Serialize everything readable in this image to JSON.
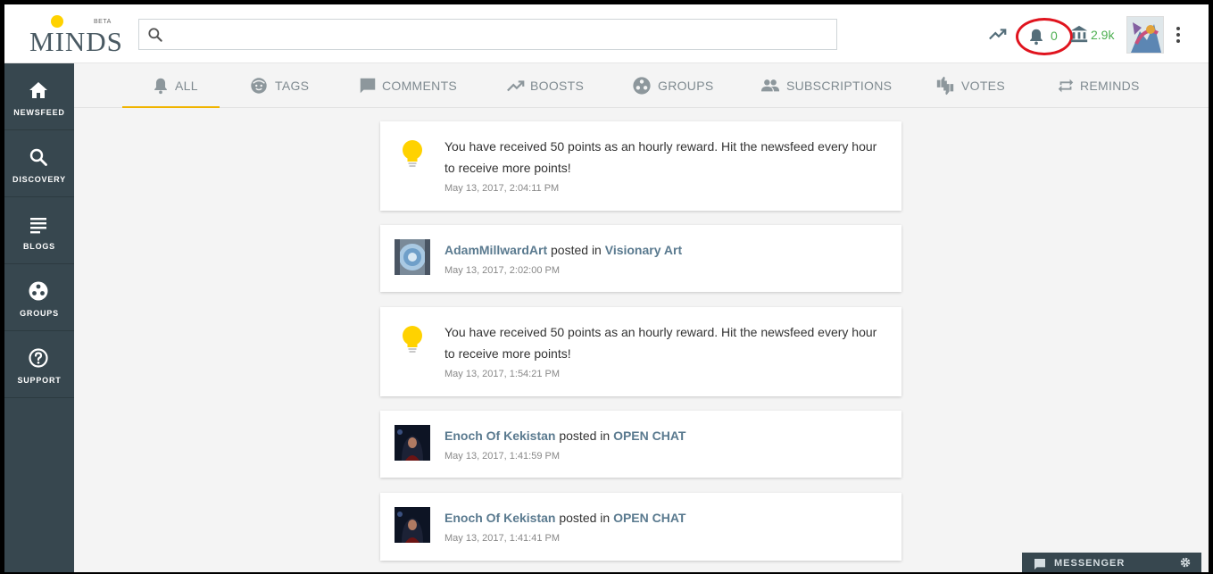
{
  "header": {
    "logo_text": "MINDS",
    "logo_badge": "BETA",
    "search_placeholder": "",
    "notification_count": "0",
    "wallet_points": "2.9k"
  },
  "sidebar": {
    "items": [
      {
        "label": "NEWSFEED",
        "icon": "home-icon"
      },
      {
        "label": "DISCOVERY",
        "icon": "search-icon"
      },
      {
        "label": "BLOGS",
        "icon": "blogs-icon"
      },
      {
        "label": "GROUPS",
        "icon": "groups-icon"
      },
      {
        "label": "SUPPORT",
        "icon": "help-icon"
      }
    ]
  },
  "tabs": [
    {
      "label": "ALL",
      "icon": "bell-icon",
      "active": true
    },
    {
      "label": "TAGS",
      "icon": "tag-face-icon"
    },
    {
      "label": "COMMENTS",
      "icon": "comment-icon"
    },
    {
      "label": "BOOSTS",
      "icon": "trending-icon"
    },
    {
      "label": "GROUPS",
      "icon": "groups-icon"
    },
    {
      "label": "SUBSCRIPTIONS",
      "icon": "people-icon"
    },
    {
      "label": "VOTES",
      "icon": "thumbs-icon"
    },
    {
      "label": "REMINDS",
      "icon": "repeat-icon"
    }
  ],
  "notifications": [
    {
      "type": "reward",
      "text": "You have received 50 points as an hourly reward. Hit the newsfeed every hour to receive more points!",
      "time": "May 13, 2017, 2:04:11 PM"
    },
    {
      "type": "post",
      "user": "AdamMillwardArt",
      "middle": "posted in",
      "group": "Visionary Art",
      "time": "May 13, 2017, 2:02:00 PM"
    },
    {
      "type": "reward",
      "text": "You have received 50 points as an hourly reward. Hit the newsfeed every hour to receive more points!",
      "time": "May 13, 2017, 1:54:21 PM"
    },
    {
      "type": "post",
      "user": "Enoch Of Kekistan",
      "middle": "posted in",
      "group": "OPEN CHAT",
      "time": "May 13, 2017, 1:41:59 PM"
    },
    {
      "type": "post",
      "user": "Enoch Of Kekistan",
      "middle": "posted in",
      "group": "OPEN CHAT",
      "time": "May 13, 2017, 1:41:41 PM"
    }
  ],
  "messenger": {
    "label": "MESSENGER"
  },
  "colors": {
    "sidebar": "#37474f",
    "accent_tab": "#f0b400",
    "points_green": "#4caf50",
    "link": "#5a7a8f",
    "highlight_circle": "#e0141e"
  }
}
